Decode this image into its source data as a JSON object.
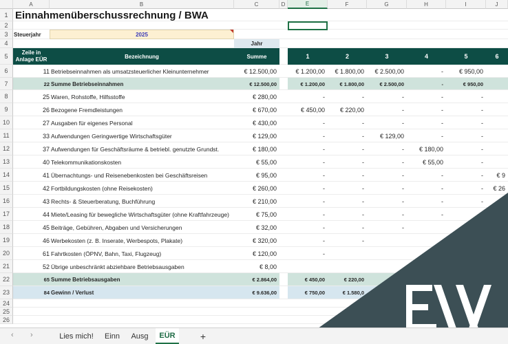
{
  "title": "Einnahmenüberschussrechnung / BWA",
  "tax_year": {
    "label": "Steuerjahr",
    "value": "2025"
  },
  "columns": [
    "A",
    "B",
    "C",
    "D",
    "E",
    "F",
    "G",
    "H",
    "I",
    "J"
  ],
  "row_numbers": [
    "1",
    "2",
    "3",
    "4",
    "5",
    "6",
    "7",
    "8",
    "9",
    "10",
    "11",
    "12",
    "13",
    "14",
    "15",
    "16",
    "17",
    "18",
    "19",
    "20",
    "21",
    "22",
    "23",
    "24",
    "25",
    "26"
  ],
  "header": {
    "zeile": "Zeile in Anlage EÜR",
    "bezeichnung": "Bezeichnung",
    "jahr": "Jahr",
    "summe": "Summe",
    "months": [
      "1",
      "2",
      "3",
      "4",
      "5",
      "6"
    ]
  },
  "rows": [
    {
      "zeile": "11",
      "bez": "Betriebseinnahmen als umsatzsteuerlicher Kleinunternehmer",
      "summe": "€ 12.500,00",
      "m": [
        "€ 1.200,00",
        "€ 1.800,00",
        "€ 2.500,00",
        "-",
        "€ 950,00",
        ""
      ],
      "type": "normal"
    },
    {
      "zeile": "22",
      "bez": "Summe Betriebseinnahmen",
      "summe": "€ 12.500,00",
      "m": [
        "€ 1.200,00",
        "€ 1.800,00",
        "€ 2.500,00",
        "-",
        "€ 950,00",
        ""
      ],
      "type": "sum"
    },
    {
      "zeile": "25",
      "bez": "Waren, Rohstoffe, Hilfsstoffe",
      "summe": "€ 280,00",
      "m": [
        "-",
        "-",
        "-",
        "-",
        "-",
        ""
      ],
      "type": "normal"
    },
    {
      "zeile": "26",
      "bez": "Bezogene Fremdleistungen",
      "summe": "€ 670,00",
      "m": [
        "€ 450,00",
        "€ 220,00",
        "-",
        "-",
        "-",
        ""
      ],
      "type": "normal"
    },
    {
      "zeile": "27",
      "bez": "Ausgaben für eigenes Personal",
      "summe": "€ 430,00",
      "m": [
        "-",
        "-",
        "-",
        "-",
        "-",
        ""
      ],
      "type": "normal"
    },
    {
      "zeile": "33",
      "bez": "Aufwendungen Geringwertige Wirtschaftsgüter",
      "summe": "€ 129,00",
      "m": [
        "-",
        "-",
        "€ 129,00",
        "-",
        "-",
        ""
      ],
      "type": "normal"
    },
    {
      "zeile": "37",
      "bez": "Aufwendungen für Geschäftsräume & betriebl. genutzte Grundst.",
      "summe": "€ 180,00",
      "m": [
        "-",
        "-",
        "-",
        "€ 180,00",
        "-",
        ""
      ],
      "type": "normal"
    },
    {
      "zeile": "40",
      "bez": "Telekommunikationskosten",
      "summe": "€ 55,00",
      "m": [
        "-",
        "-",
        "-",
        "€ 55,00",
        "-",
        ""
      ],
      "type": "normal"
    },
    {
      "zeile": "41",
      "bez": "Übernachtungs- und Reisenebenkosten bei Geschäftsreisen",
      "summe": "€ 95,00",
      "m": [
        "-",
        "-",
        "-",
        "-",
        "-",
        "€ 9"
      ],
      "type": "normal"
    },
    {
      "zeile": "42",
      "bez": "Fortbildungskosten (ohne Reisekosten)",
      "summe": "€ 260,00",
      "m": [
        "-",
        "-",
        "-",
        "-",
        "-",
        "€ 26"
      ],
      "type": "normal"
    },
    {
      "zeile": "43",
      "bez": "Rechts- & Steuerberatung, Buchführung",
      "summe": "€ 210,00",
      "m": [
        "-",
        "-",
        "-",
        "-",
        "-",
        ""
      ],
      "type": "normal"
    },
    {
      "zeile": "44",
      "bez": "Miete/Leasing für bewegliche Wirtschaftsgüter (ohne Kraftfahrzeuge)",
      "summe": "€ 75,00",
      "m": [
        "-",
        "-",
        "-",
        "-",
        "",
        ""
      ],
      "type": "normal"
    },
    {
      "zeile": "45",
      "bez": "Beiträge, Gebühren, Abgaben und Versicherungen",
      "summe": "€ 32,00",
      "m": [
        "-",
        "-",
        "-",
        "",
        "",
        ""
      ],
      "type": "normal"
    },
    {
      "zeile": "46",
      "bez": "Werbekosten (z. B. Inserate, Werbespots, Plakate)",
      "summe": "€ 320,00",
      "m": [
        "-",
        "-",
        "",
        "",
        "",
        ""
      ],
      "type": "normal"
    },
    {
      "zeile": "61",
      "bez": "Fahrtkosten (ÖPNV, Bahn, Taxi, Flugzeug)",
      "summe": "€ 120,00",
      "m": [
        "-",
        "",
        "",
        "",
        "",
        ""
      ],
      "type": "normal"
    },
    {
      "zeile": "52",
      "bez": "Übrige unbeschränkt abziehbare Betriebsausgaben",
      "summe": "€ 8,00",
      "m": [
        "",
        "",
        "",
        "",
        "",
        ""
      ],
      "type": "normal"
    },
    {
      "zeile": "65",
      "bez": "Summe Betriebsausgaben",
      "summe": "€ 2.864,00",
      "m": [
        "€ 450,00",
        "€ 220,00",
        "",
        "",
        "",
        ""
      ],
      "type": "sum"
    },
    {
      "zeile": "84",
      "bez": "Gewinn / Verlust",
      "summe": "€ 9.636,00",
      "m": [
        "€ 750,00",
        "€ 1.580,0",
        "",
        "",
        "",
        ""
      ],
      "type": "total"
    }
  ],
  "sheet_tabs": [
    "Lies mich!",
    "Einn",
    "Ausg",
    "EÜR"
  ],
  "active_tab": "EÜR",
  "add_sheet_label": "+",
  "nav_prev": "‹",
  "nav_next": "›",
  "logo_text": "EW",
  "colors": {
    "header": "#0d4d45",
    "sum_row": "#cfe3dc",
    "total_row": "#d6e6ef",
    "year_input": "#fdf0d2",
    "overlay": "#3c4f55",
    "accent": "#1e7145"
  }
}
